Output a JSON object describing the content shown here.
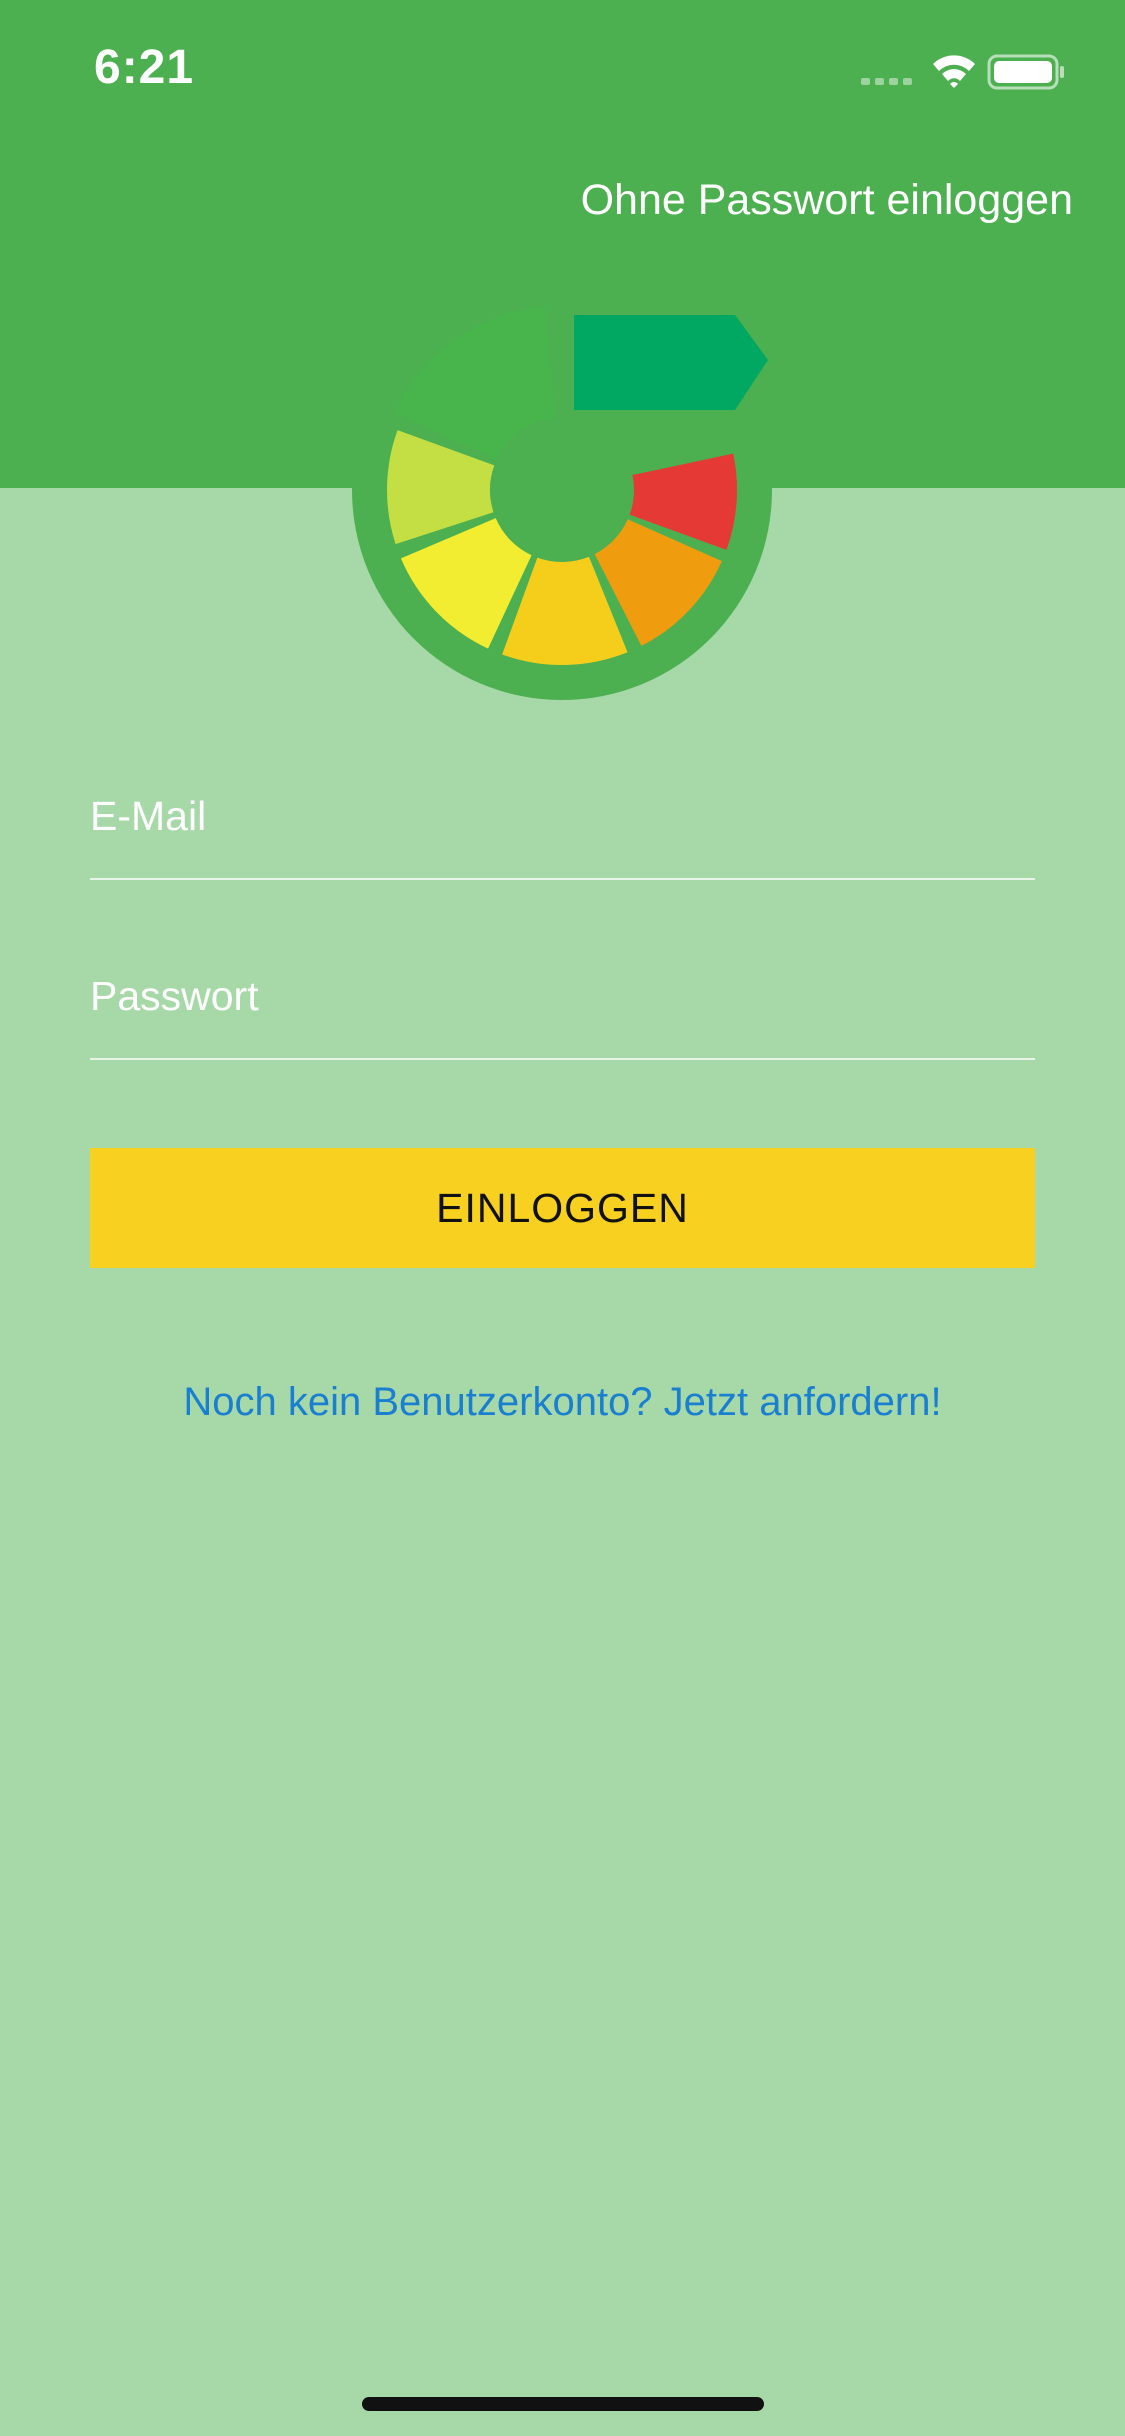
{
  "status_bar": {
    "time": "6:21",
    "icons": [
      "signal-icon",
      "wifi-icon",
      "battery-icon"
    ]
  },
  "header": {
    "passwordless_link": "Ohne Passwort einloggen",
    "background_color": "#4caf50"
  },
  "logo": {
    "icon": "segmented-wheel-logo",
    "segment_colors": [
      "#00a862",
      "#e53935",
      "#f09c0f",
      "#f5ce1c",
      "#f3ed32",
      "#c3df43",
      "#47b54c"
    ]
  },
  "form": {
    "email_placeholder": "E-Mail",
    "password_placeholder": "Passwort",
    "login_button": "EINLOGGEN",
    "button_color": "#f7d020"
  },
  "register_link": "Noch kein Benutzerkonto? Jetzt anfordern!",
  "colors": {
    "page_background": "#a7d9a8",
    "link_color": "#1a7fd0"
  }
}
